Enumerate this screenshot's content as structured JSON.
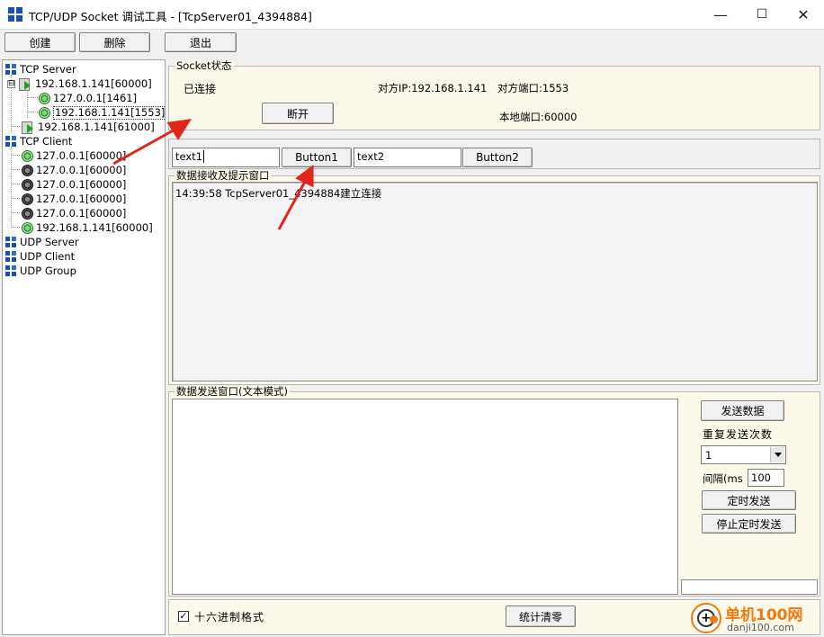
{
  "window": {
    "title": "TCP/UDP Socket 调试工具 - [TcpServer01_4394884]",
    "minimize_glyph": "—",
    "maximize_glyph": "☐",
    "close_glyph": "✕"
  },
  "toolbar": {
    "create_label": "创建",
    "delete_label": "删除",
    "exit_label": "退出"
  },
  "tree": {
    "tcp_server": {
      "label": "TCP Server",
      "servers": [
        {
          "label": "192.168.1.141[60000]",
          "expander": "⊟",
          "connections": [
            {
              "label": "127.0.0.1[1461]"
            },
            {
              "label": "192.168.1.141[1553]"
            }
          ]
        },
        {
          "label": "192.168.1.141[61000]"
        }
      ]
    },
    "tcp_client": {
      "label": "TCP Client",
      "clients": [
        {
          "label": "127.0.0.1[60000]",
          "status": "connected"
        },
        {
          "label": "127.0.0.1[60000]",
          "status": "disconnected"
        },
        {
          "label": "127.0.0.1[60000]",
          "status": "disconnected"
        },
        {
          "label": "127.0.0.1[60000]",
          "status": "disconnected"
        },
        {
          "label": "127.0.0.1[60000]",
          "status": "disconnected"
        },
        {
          "label": "192.168.1.141[60000]",
          "status": "connected"
        }
      ]
    },
    "udp_server": {
      "label": "UDP Server"
    },
    "udp_client": {
      "label": "UDP Client"
    },
    "udp_group": {
      "label": "UDP Group"
    }
  },
  "socket_status": {
    "legend": "Socket状态",
    "state": "已连接",
    "peer_ip": "对方IP:192.168.1.141",
    "peer_port": "对方端口:1553",
    "local_port": "本地端口:60000",
    "disconnect_label": "断开"
  },
  "quickbar": {
    "text1_value": "text1",
    "button1_label": "Button1",
    "text2_value": "text2",
    "button2_label": "Button2"
  },
  "receive": {
    "legend": "数据接收及提示窗口",
    "log": "14:39:58 TcpServer01_4394884建立连接"
  },
  "send": {
    "legend": "数据发送窗口(文本模式)",
    "send_label": "发送数据",
    "repeat_label": "重复发送次数",
    "repeat_value": "1",
    "interval_label": "间隔(ms",
    "interval_value": "100",
    "timed_send_label": "定时发送",
    "stop_timed_label": "停止定时发送"
  },
  "bottom": {
    "hex_label": "十六进制格式",
    "hex_checked": true,
    "clear_stats_label": "统计清零"
  },
  "watermark": {
    "text": "单机100网",
    "subtext": "danji100.com"
  },
  "colors": {
    "panel_bg": "#fcf8ea",
    "icon_blue": "#1a4fb6",
    "arrow_red": "#e0251b"
  }
}
